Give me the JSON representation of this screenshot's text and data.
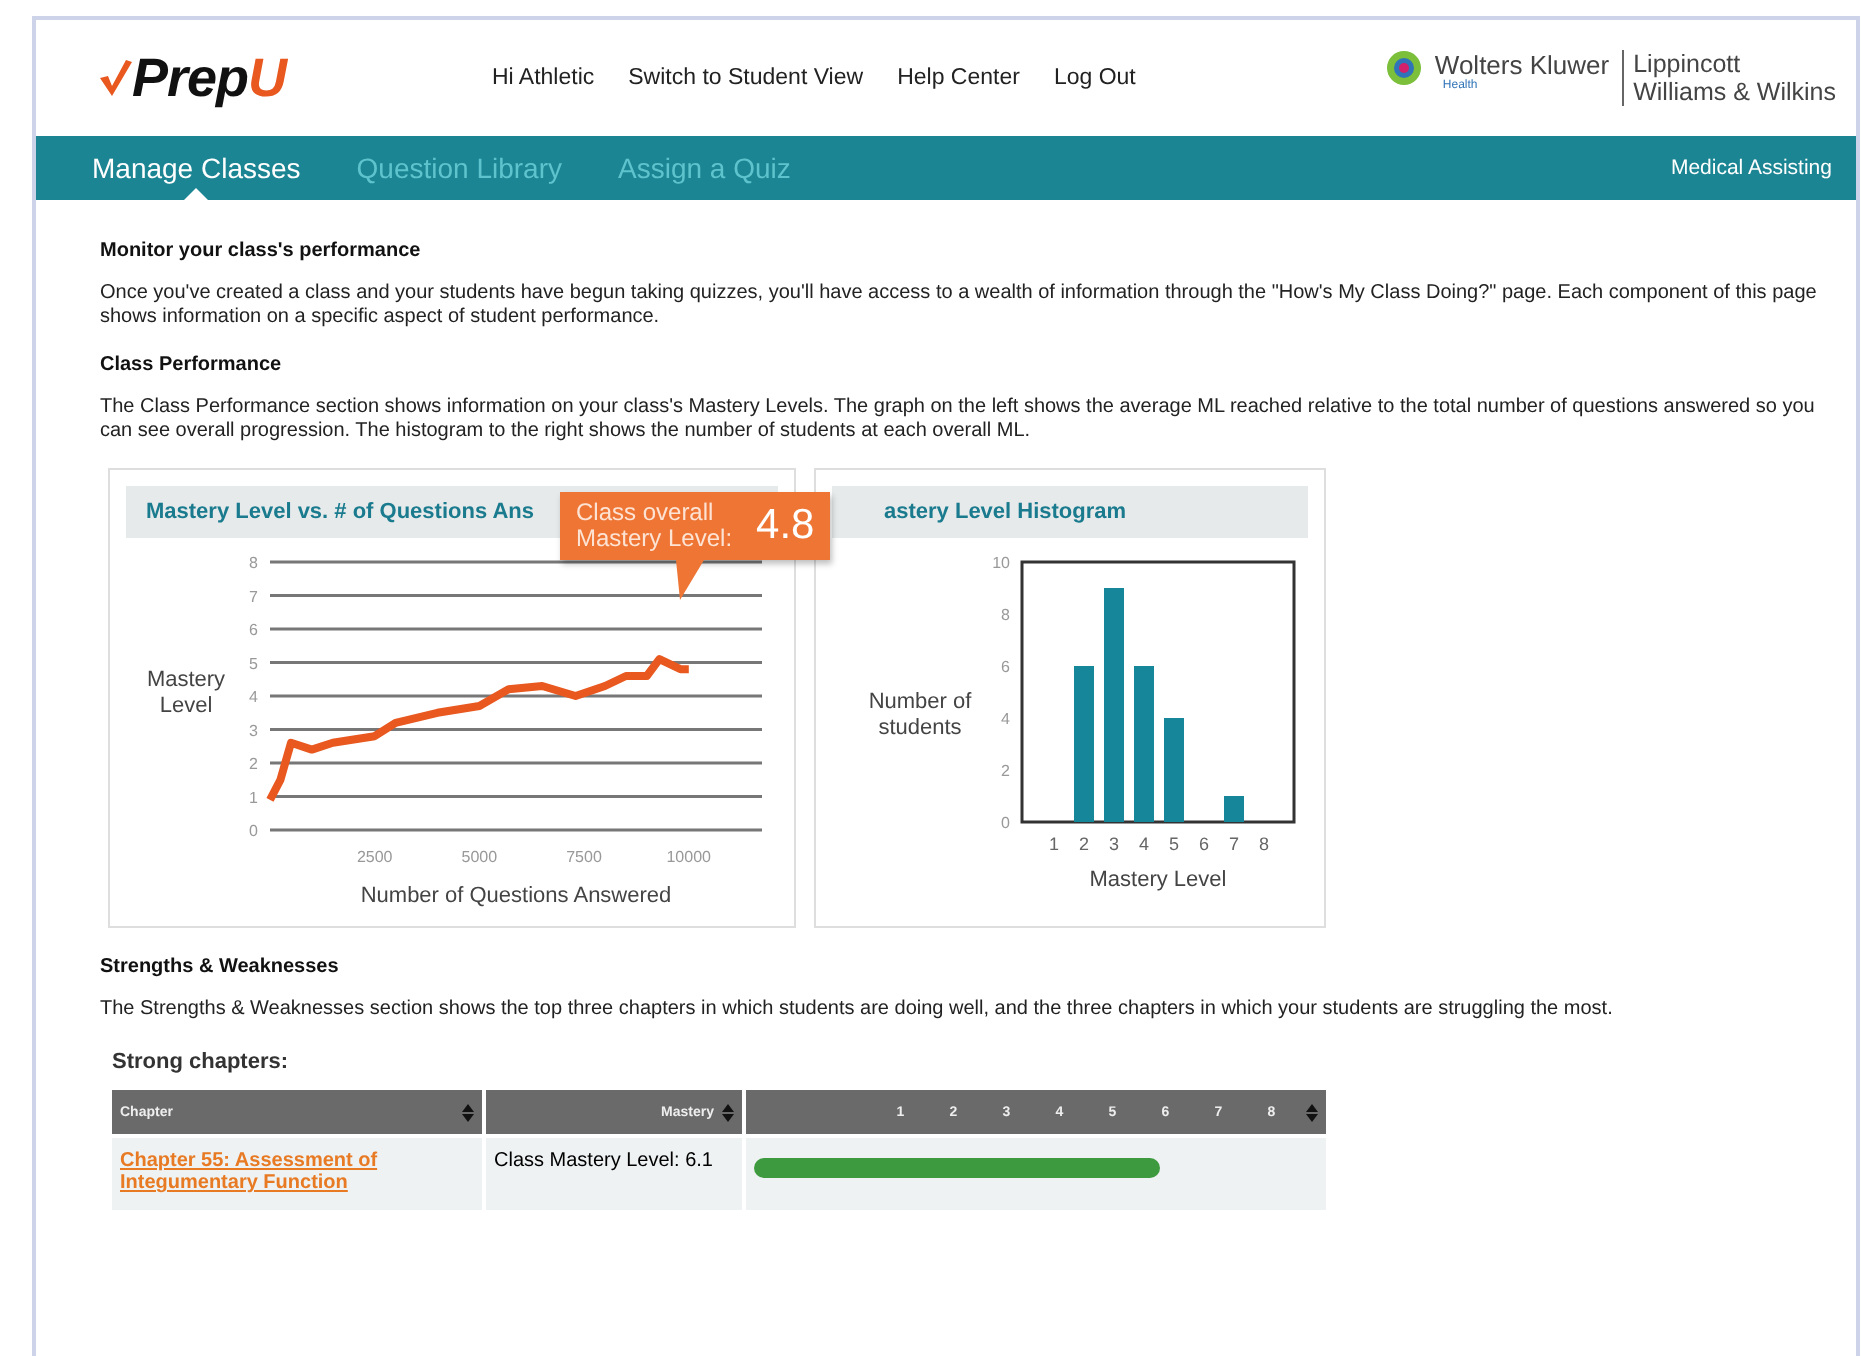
{
  "header": {
    "logo": {
      "main": "Prep",
      "accent": "U"
    },
    "links": [
      "Hi Athletic",
      "Switch to Student View",
      "Help Center",
      "Log Out"
    ],
    "publisher": {
      "name": "Wolters Kluwer",
      "division": "Health",
      "imprint_1": "Lippincott",
      "imprint_2": "Williams & Wilkins"
    }
  },
  "nav": {
    "tabs": [
      {
        "label": "Manage Classes",
        "selected": true
      },
      {
        "label": "Question Library",
        "selected": false
      },
      {
        "label": "Assign a Quiz",
        "selected": false
      }
    ],
    "course": "Medical Assisting"
  },
  "sections": [
    {
      "heading": "Monitor your class's performance",
      "text": "Once you've created a class and your students have begun taking quizzes, you'll have access to a wealth of information through the \"How's My Class Doing?\" page. Each component of this page shows information on a specific aspect of student performance."
    },
    {
      "heading": "Class Performance",
      "text": "The Class Performance section shows information on your class's Mastery Levels. The graph on the left shows the average ML reached relative to the total number of questions answered so you can see overall progression. The histogram to the right shows the number of students at each overall ML."
    }
  ],
  "charts": [
    {
      "title": "Mastery Level vs. # of Questions Ans",
      "chart_data": {
        "type": "line",
        "xlabel": "Number of Questions Answered",
        "ylabel": "Mastery Level",
        "x": [
          0,
          250,
          500,
          1000,
          1500,
          2500,
          3000,
          4000,
          5000,
          5700,
          6500,
          7300,
          8000,
          8500,
          9000,
          9300,
          9800,
          10000
        ],
        "grid": true,
        "series": [
          {
            "color": "#e8581f",
            "values": [
              0.9,
              1.5,
              2.6,
              2.4,
              2.6,
              2.8,
              3.2,
              3.5,
              3.7,
              4.2,
              4.3,
              4.0,
              4.3,
              4.6,
              4.6,
              5.1,
              4.8,
              4.8
            ]
          }
        ],
        "xlim": [
          0,
          11750
        ],
        "ylim": [
          0,
          8
        ],
        "xticks": [
          2500,
          5000,
          7500,
          10000
        ],
        "yticks": [
          0,
          1,
          2,
          3,
          4,
          5,
          6,
          7,
          8
        ]
      }
    },
    {
      "title": "astery Level Histogram",
      "chart_data": {
        "type": "bar",
        "xlabel": "Mastery Level",
        "ylabel": "Number of students",
        "categories": [
          "1",
          "2",
          "3",
          "4",
          "5",
          "6",
          "7",
          "8"
        ],
        "series": [
          {
            "color": "#16879a",
            "values": [
              0,
              6,
              9,
              6,
              4,
              0,
              1,
              0
            ]
          }
        ],
        "ylim": [
          0,
          10
        ],
        "yticks": [
          0,
          2,
          4,
          6,
          8,
          10
        ]
      }
    }
  ],
  "callout": {
    "label_1": "Class overall",
    "label_2": "Mastery Level:",
    "value": "4.8"
  },
  "strengths": {
    "heading": "Strengths & Weaknesses",
    "text": "The Strengths & Weaknesses section shows the top three chapters in which students are doing well, and the three chapters in which your students are struggling the most.",
    "subheading": "Strong chapters:",
    "columns": [
      "Chapter",
      "Mastery"
    ],
    "scale": [
      "1",
      "2",
      "3",
      "4",
      "5",
      "6",
      "7",
      "8"
    ],
    "rows": [
      {
        "chapter": "Chapter 55: Assessment of Integumentary Function",
        "mastery": "Class Mastery Level: 6.1",
        "level": 0.72
      }
    ]
  }
}
